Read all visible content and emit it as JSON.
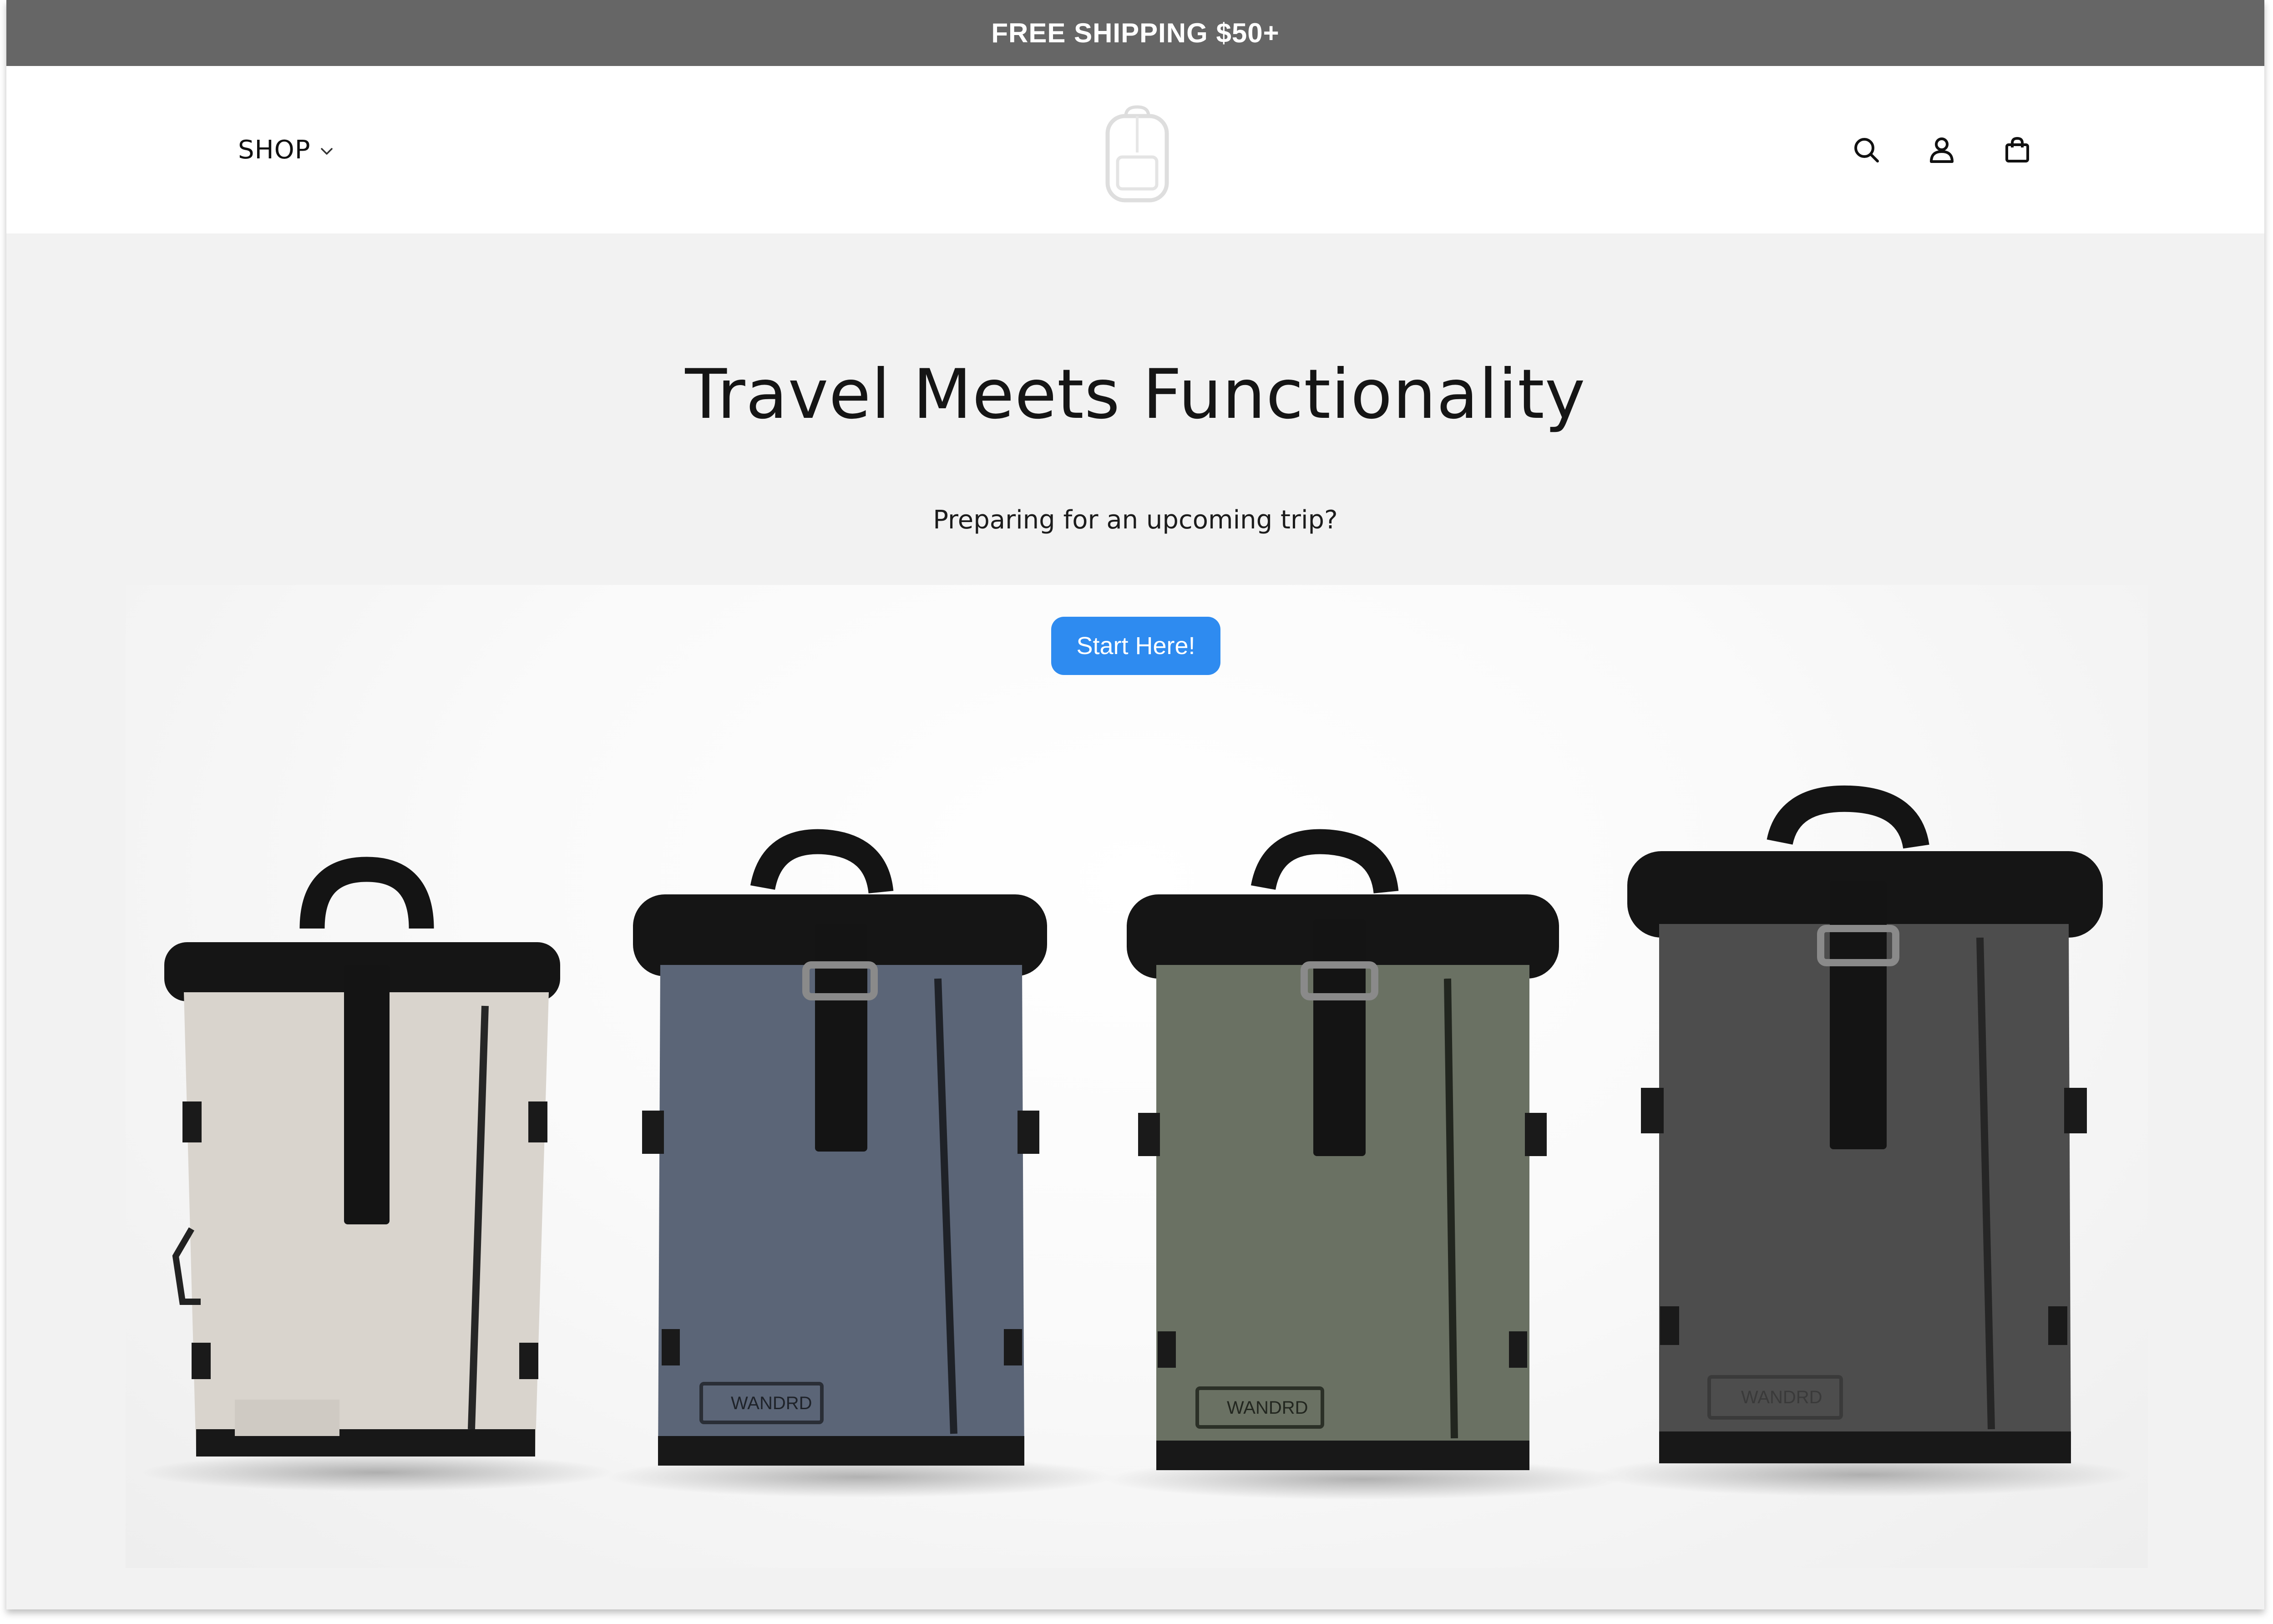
{
  "announcement": {
    "text": "FREE SHIPPING $50+"
  },
  "header": {
    "nav": {
      "shop_label": "SHOP",
      "chevron_icon": "chevron-down-icon"
    },
    "logo_icon": "backpack-logo-icon",
    "icons": [
      "search-icon",
      "account-icon",
      "cart-bag-icon"
    ]
  },
  "hero": {
    "title": "Travel Meets Functionality",
    "subtitle": "Preparing for an upcoming trip?",
    "cta_label": "Start Here!",
    "cta_color": "#2e8bf0"
  },
  "products": {
    "brand_mark": "WANDRD",
    "backpacks": [
      {
        "color_name": "sand",
        "body_color": "#d9d4cd"
      },
      {
        "color_name": "slate blue",
        "body_color": "#5b6577"
      },
      {
        "color_name": "olive",
        "body_color": "#6a7163"
      },
      {
        "color_name": "black",
        "body_color": "#4d4d4d"
      }
    ]
  }
}
